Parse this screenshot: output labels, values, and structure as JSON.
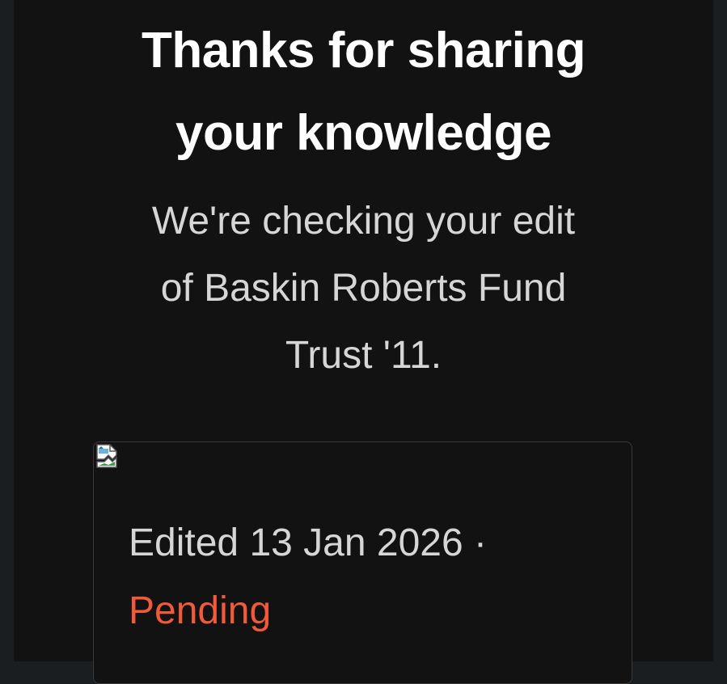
{
  "heading": {
    "line1": "Thanks for sharing",
    "line2": "your knowledge"
  },
  "message": {
    "line1": "We're checking your edit",
    "line2": "of Baskin Roberts Fund",
    "line3": "Trust '11."
  },
  "edit_card": {
    "image_icon": "broken-image-icon",
    "edited_text": "Edited 13 Jan 2026 ·",
    "status": "Pending",
    "status_color": "#f05a3a"
  }
}
